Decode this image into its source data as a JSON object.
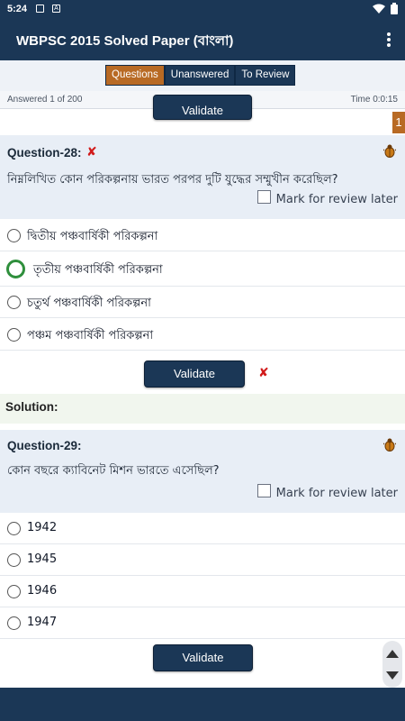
{
  "status_bar": {
    "time": "5:24",
    "icons": [
      "image-icon",
      "notification-icon",
      "wifi-icon",
      "battery-icon"
    ]
  },
  "app_bar": {
    "title": "WBPSC 2015 Solved Paper (বাংলা)",
    "menu_icon": "more-vert-icon"
  },
  "tabs": [
    {
      "label": "Questions",
      "active": true
    },
    {
      "label": "Unanswered",
      "active": false
    },
    {
      "label": "To Review",
      "active": false
    }
  ],
  "info": {
    "answered": "Answered 1 of 200",
    "time": "Time 0:0:15"
  },
  "page_badge": "1",
  "prev_validate_label": "Validate",
  "questions": [
    {
      "label": "Question-28:",
      "status": "wrong",
      "text": "নিম্নলিখিত কোন পরিকল্পনায় ভারত পরপর দুটি যুদ্ধের সম্মুখীন করেছিল?",
      "mark_label": "Mark for review later",
      "options": [
        {
          "text": "দ্বিতীয় পঞ্চবার্ষিকী পরিকল্পনা",
          "selected": false
        },
        {
          "text": "তৃতীয় পঞ্চবার্ষিকী পরিকল্পনা",
          "selected": true
        },
        {
          "text": "চতুর্থ পঞ্চবার্ষিকী পরিকল্পনা",
          "selected": false
        },
        {
          "text": "পঞ্চম পঞ্চবার্ষিকী পরিকল্পনা",
          "selected": false
        }
      ],
      "validate_label": "Validate",
      "solution_label": "Solution:"
    },
    {
      "label": "Question-29:",
      "text": "কোন বছরে ক্যাবিনেট মিশন ভারতে এসেছিল?",
      "mark_label": "Mark for review later",
      "options": [
        {
          "text": "1942",
          "selected": false
        },
        {
          "text": "1945",
          "selected": false
        },
        {
          "text": "1946",
          "selected": false
        },
        {
          "text": "1947",
          "selected": false
        }
      ],
      "validate_label": "Validate"
    }
  ],
  "colors": {
    "primary": "#1b3756",
    "accent": "#b86a24",
    "wrong": "#d11a1a",
    "selected": "#2f8f3c"
  }
}
